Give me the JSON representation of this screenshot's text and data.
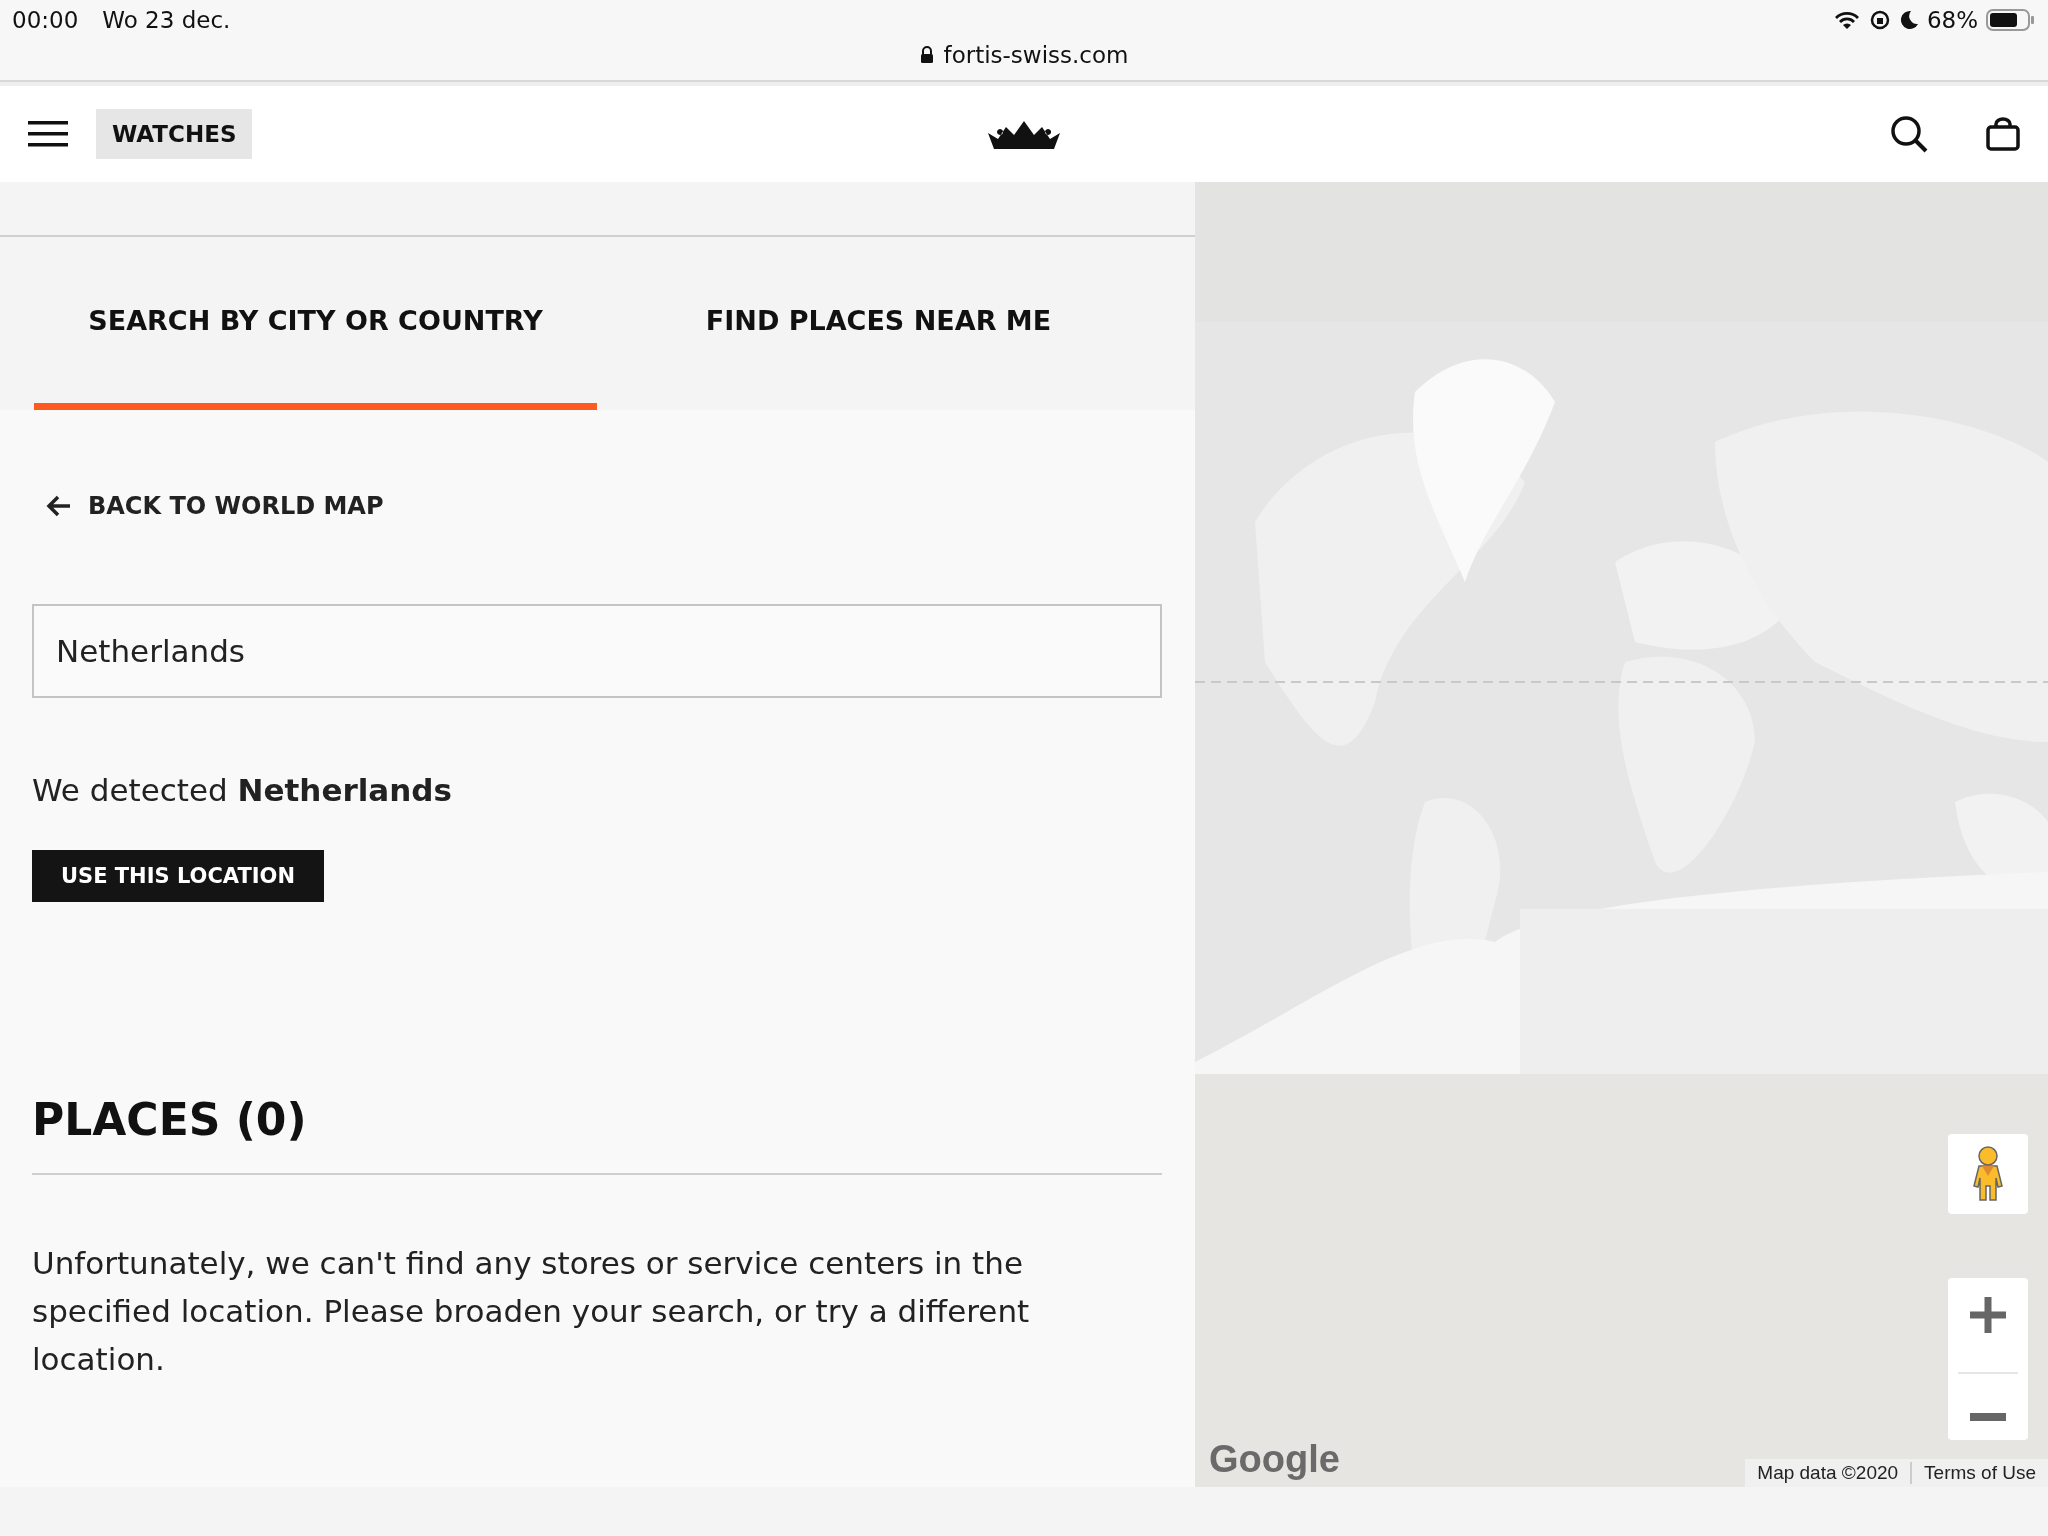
{
  "status_bar": {
    "time": "00:00",
    "date": "Wo 23 dec.",
    "battery": "68%",
    "url": "fortis-swiss.com"
  },
  "nav": {
    "category": "WATCHES"
  },
  "tabs": [
    {
      "label": "SEARCH BY CITY OR COUNTRY",
      "selected": true
    },
    {
      "label": "FIND PLACES NEAR ME",
      "selected": false
    }
  ],
  "back_link": "BACK TO WORLD MAP",
  "search": {
    "value": "Netherlands"
  },
  "detected": "We detected **Netherlands**",
  "use_location_button": "USE THIS LOCATION",
  "places_heading": "PLACES (0)",
  "message": "Unfortunately, we can't find any stores or service centers in the specified location. Please broaden your search, or try a different location.",
  "map": {
    "kind": "picture",
    "logo": "Google",
    "attribution": "Map data ©2020",
    "terms": "Terms of Use"
  }
}
